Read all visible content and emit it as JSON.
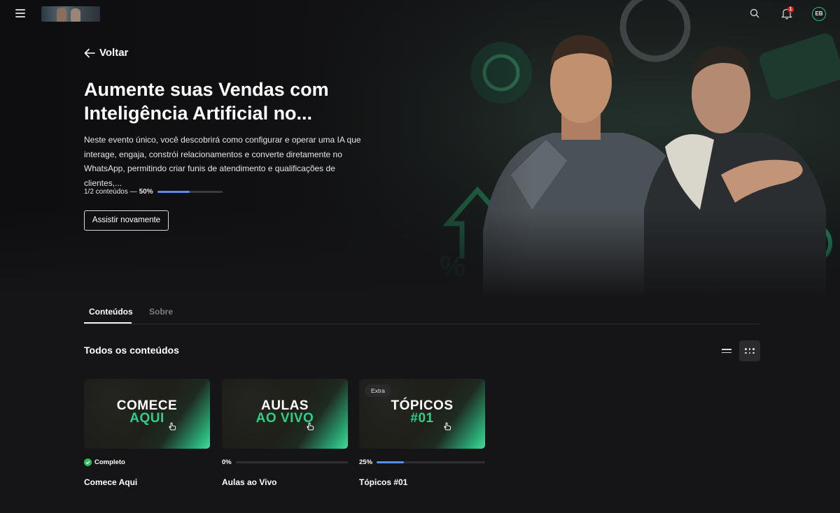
{
  "header": {
    "menu_icon": "hamburger-menu-icon",
    "search_icon": "search-icon",
    "bell_icon": "bell-icon",
    "notification_count": "1",
    "avatar_initials": "EB",
    "accent_color": "#2dbd7e"
  },
  "hero": {
    "back_label": "Voltar",
    "title": "Aumente suas Vendas com Inteligência Artificial no...",
    "description": "Neste evento único, você descobrirá como configurar e operar uma IA que interage, engaja, constrói relacionamentos e converte diretamente no WhatsApp, permitindo criar funis de atendimento e qualificações de clientes,...",
    "progress_text": "1/2 conteúdos —",
    "progress_percent_label": "50%",
    "progress_value": 0.5,
    "rewatch_label": "Assistir novamente"
  },
  "tabs": [
    {
      "label": "Conteúdos",
      "active": true
    },
    {
      "label": "Sobre",
      "active": false
    }
  ],
  "section": {
    "title": "Todos os conteúdos",
    "view_list_icon": "list-view-icon",
    "view_grid_icon": "grid-view-icon"
  },
  "cards": [
    {
      "thumb_line1": "COMECE",
      "thumb_line2": "AQUI",
      "badge": "",
      "status_label": "Completo",
      "progress_value": 1.0,
      "completed": true,
      "title": "Comece Aqui"
    },
    {
      "thumb_line1": "AULAS",
      "thumb_line2": "AO VIVO",
      "badge": "",
      "status_label": "0%",
      "progress_value": 0.0,
      "completed": false,
      "title": "Aulas ao Vivo"
    },
    {
      "thumb_line1": "TÓPICOS",
      "thumb_line2": "#01",
      "badge": "Extra",
      "status_label": "25%",
      "progress_value": 0.25,
      "completed": false,
      "title": "Tópicos #01"
    }
  ],
  "colors": {
    "progress": "#5b8def",
    "brand_green": "#2fcf8a",
    "background": "#151517"
  }
}
